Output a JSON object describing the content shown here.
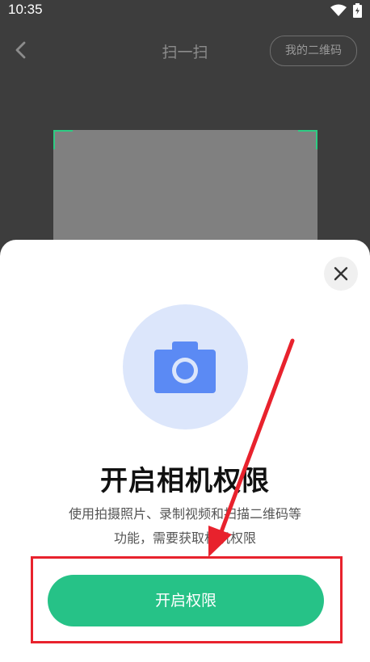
{
  "status_bar": {
    "time": "10:35"
  },
  "header": {
    "title": "扫一扫",
    "my_qr_label": "我的二维码"
  },
  "permission_sheet": {
    "title": "开启相机权限",
    "description_line1": "使用拍摄照片、录制视频和扫描二维码等",
    "description_line2": "功能，需要获取相机权限",
    "enable_button_label": "开启权限"
  },
  "colors": {
    "accent_green": "#26c287",
    "camera_blue": "#5b8af4",
    "camera_bg": "#dce6fb",
    "annotation_red": "#e8222d"
  },
  "icons": [
    "back-icon",
    "wifi-icon",
    "battery-icon",
    "close-icon",
    "camera-icon"
  ]
}
